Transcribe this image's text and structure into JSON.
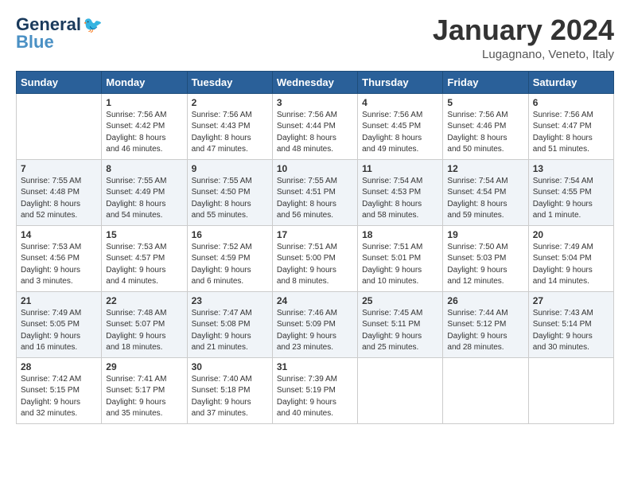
{
  "header": {
    "logo_general": "General",
    "logo_blue": "Blue",
    "title": "January 2024",
    "location": "Lugagnano, Veneto, Italy"
  },
  "columns": [
    "Sunday",
    "Monday",
    "Tuesday",
    "Wednesday",
    "Thursday",
    "Friday",
    "Saturday"
  ],
  "weeks": [
    [
      {
        "day": "",
        "info": ""
      },
      {
        "day": "1",
        "info": "Sunrise: 7:56 AM\nSunset: 4:42 PM\nDaylight: 8 hours\nand 46 minutes."
      },
      {
        "day": "2",
        "info": "Sunrise: 7:56 AM\nSunset: 4:43 PM\nDaylight: 8 hours\nand 47 minutes."
      },
      {
        "day": "3",
        "info": "Sunrise: 7:56 AM\nSunset: 4:44 PM\nDaylight: 8 hours\nand 48 minutes."
      },
      {
        "day": "4",
        "info": "Sunrise: 7:56 AM\nSunset: 4:45 PM\nDaylight: 8 hours\nand 49 minutes."
      },
      {
        "day": "5",
        "info": "Sunrise: 7:56 AM\nSunset: 4:46 PM\nDaylight: 8 hours\nand 50 minutes."
      },
      {
        "day": "6",
        "info": "Sunrise: 7:56 AM\nSunset: 4:47 PM\nDaylight: 8 hours\nand 51 minutes."
      }
    ],
    [
      {
        "day": "7",
        "info": "Sunrise: 7:55 AM\nSunset: 4:48 PM\nDaylight: 8 hours\nand 52 minutes."
      },
      {
        "day": "8",
        "info": "Sunrise: 7:55 AM\nSunset: 4:49 PM\nDaylight: 8 hours\nand 54 minutes."
      },
      {
        "day": "9",
        "info": "Sunrise: 7:55 AM\nSunset: 4:50 PM\nDaylight: 8 hours\nand 55 minutes."
      },
      {
        "day": "10",
        "info": "Sunrise: 7:55 AM\nSunset: 4:51 PM\nDaylight: 8 hours\nand 56 minutes."
      },
      {
        "day": "11",
        "info": "Sunrise: 7:54 AM\nSunset: 4:53 PM\nDaylight: 8 hours\nand 58 minutes."
      },
      {
        "day": "12",
        "info": "Sunrise: 7:54 AM\nSunset: 4:54 PM\nDaylight: 8 hours\nand 59 minutes."
      },
      {
        "day": "13",
        "info": "Sunrise: 7:54 AM\nSunset: 4:55 PM\nDaylight: 9 hours\nand 1 minute."
      }
    ],
    [
      {
        "day": "14",
        "info": "Sunrise: 7:53 AM\nSunset: 4:56 PM\nDaylight: 9 hours\nand 3 minutes."
      },
      {
        "day": "15",
        "info": "Sunrise: 7:53 AM\nSunset: 4:57 PM\nDaylight: 9 hours\nand 4 minutes."
      },
      {
        "day": "16",
        "info": "Sunrise: 7:52 AM\nSunset: 4:59 PM\nDaylight: 9 hours\nand 6 minutes."
      },
      {
        "day": "17",
        "info": "Sunrise: 7:51 AM\nSunset: 5:00 PM\nDaylight: 9 hours\nand 8 minutes."
      },
      {
        "day": "18",
        "info": "Sunrise: 7:51 AM\nSunset: 5:01 PM\nDaylight: 9 hours\nand 10 minutes."
      },
      {
        "day": "19",
        "info": "Sunrise: 7:50 AM\nSunset: 5:03 PM\nDaylight: 9 hours\nand 12 minutes."
      },
      {
        "day": "20",
        "info": "Sunrise: 7:49 AM\nSunset: 5:04 PM\nDaylight: 9 hours\nand 14 minutes."
      }
    ],
    [
      {
        "day": "21",
        "info": "Sunrise: 7:49 AM\nSunset: 5:05 PM\nDaylight: 9 hours\nand 16 minutes."
      },
      {
        "day": "22",
        "info": "Sunrise: 7:48 AM\nSunset: 5:07 PM\nDaylight: 9 hours\nand 18 minutes."
      },
      {
        "day": "23",
        "info": "Sunrise: 7:47 AM\nSunset: 5:08 PM\nDaylight: 9 hours\nand 21 minutes."
      },
      {
        "day": "24",
        "info": "Sunrise: 7:46 AM\nSunset: 5:09 PM\nDaylight: 9 hours\nand 23 minutes."
      },
      {
        "day": "25",
        "info": "Sunrise: 7:45 AM\nSunset: 5:11 PM\nDaylight: 9 hours\nand 25 minutes."
      },
      {
        "day": "26",
        "info": "Sunrise: 7:44 AM\nSunset: 5:12 PM\nDaylight: 9 hours\nand 28 minutes."
      },
      {
        "day": "27",
        "info": "Sunrise: 7:43 AM\nSunset: 5:14 PM\nDaylight: 9 hours\nand 30 minutes."
      }
    ],
    [
      {
        "day": "28",
        "info": "Sunrise: 7:42 AM\nSunset: 5:15 PM\nDaylight: 9 hours\nand 32 minutes."
      },
      {
        "day": "29",
        "info": "Sunrise: 7:41 AM\nSunset: 5:17 PM\nDaylight: 9 hours\nand 35 minutes."
      },
      {
        "day": "30",
        "info": "Sunrise: 7:40 AM\nSunset: 5:18 PM\nDaylight: 9 hours\nand 37 minutes."
      },
      {
        "day": "31",
        "info": "Sunrise: 7:39 AM\nSunset: 5:19 PM\nDaylight: 9 hours\nand 40 minutes."
      },
      {
        "day": "",
        "info": ""
      },
      {
        "day": "",
        "info": ""
      },
      {
        "day": "",
        "info": ""
      }
    ]
  ]
}
